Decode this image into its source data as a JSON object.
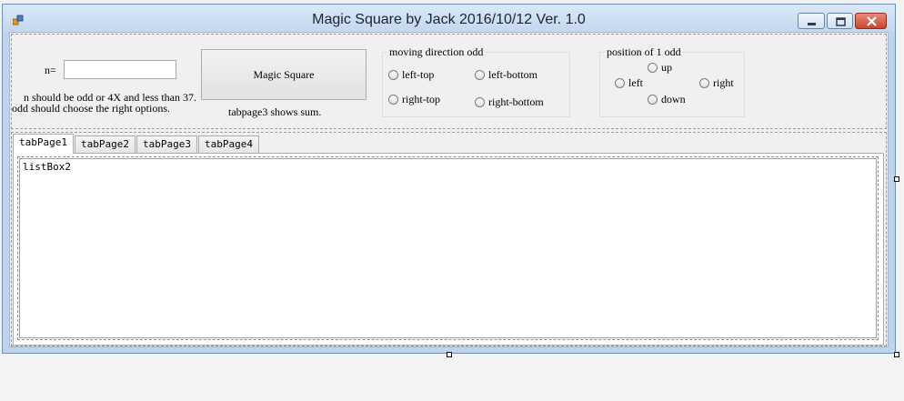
{
  "window": {
    "title": "Magic Square by  Jack  2016/10/12 Ver. 1.0"
  },
  "controls": {
    "minimize_icon": "minimize-icon",
    "maximize_icon": "maximize-icon",
    "close_icon": "close-icon"
  },
  "input": {
    "n_label": "n=",
    "n_value": ""
  },
  "hint": {
    "line1": "n should be odd or 4X and less than 37.",
    "line2": "odd should choose the right options."
  },
  "magic_button": {
    "label": "Magic Square"
  },
  "tabpage3_note": "tabpage3 shows sum.",
  "moving_direction": {
    "title": "moving direction odd",
    "options": [
      "left-top",
      "left-bottom",
      "right-top",
      "right-bottom"
    ]
  },
  "position": {
    "title": "position of 1 odd",
    "options": {
      "up": "up",
      "left": "left",
      "right": "right",
      "down": "down"
    }
  },
  "tabs": [
    "tabPage1",
    "tabPage2",
    "tabPage3",
    "tabPage4"
  ],
  "active_tab": "tabPage1",
  "listbox": {
    "label": "listBox2"
  },
  "colors": {
    "titlebar": "#c3d7ef",
    "close_button": "#c74632",
    "form_bg": "#f0f0f0"
  }
}
